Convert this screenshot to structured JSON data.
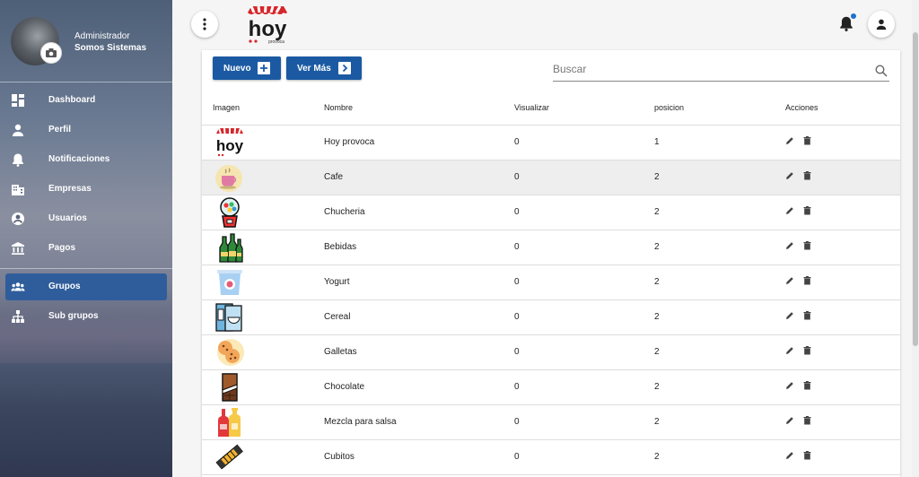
{
  "user": {
    "role": "Administrador",
    "company": "Somos Sistemas"
  },
  "nav": {
    "primary": [
      {
        "label": "Dashboard",
        "icon": "dashboard-icon"
      },
      {
        "label": "Perfil",
        "icon": "person-icon"
      },
      {
        "label": "Notificaciones",
        "icon": "bell-icon"
      },
      {
        "label": "Empresas",
        "icon": "building-icon"
      },
      {
        "label": "Usuarios",
        "icon": "account-circle-icon"
      },
      {
        "label": "Pagos",
        "icon": "bank-icon"
      }
    ],
    "secondary": [
      {
        "label": "Grupos",
        "icon": "groups-icon",
        "active": true
      },
      {
        "label": "Sub grupos",
        "icon": "hierarchy-icon"
      }
    ]
  },
  "brand": {
    "logo_text": "hoy",
    "logo_sub": "provoca",
    "accent": "#d6262b"
  },
  "toolbar": {
    "new_label": "Nuevo",
    "more_label": "Ver Más"
  },
  "search": {
    "placeholder": "Buscar",
    "value": ""
  },
  "table": {
    "headers": [
      "Imagen",
      "Nombre",
      "Visualizar",
      "posicion",
      "Acciones"
    ],
    "rows": [
      {
        "icon": "hoy-provoca-logo",
        "name": "Hoy provoca",
        "visualizar": "0",
        "posicion": "1"
      },
      {
        "icon": "coffee-cup-icon",
        "name": "Cafe",
        "visualizar": "0",
        "posicion": "2"
      },
      {
        "icon": "gumball-machine-icon",
        "name": "Chucheria",
        "visualizar": "0",
        "posicion": "2"
      },
      {
        "icon": "bottles-icon",
        "name": "Bebidas",
        "visualizar": "0",
        "posicion": "2"
      },
      {
        "icon": "yogurt-cup-icon",
        "name": "Yogurt",
        "visualizar": "0",
        "posicion": "2"
      },
      {
        "icon": "cereal-box-icon",
        "name": "Cereal",
        "visualizar": "0",
        "posicion": "2"
      },
      {
        "icon": "cookies-icon",
        "name": "Galletas",
        "visualizar": "0",
        "posicion": "2"
      },
      {
        "icon": "chocolate-bar-icon",
        "name": "Chocolate",
        "visualizar": "0",
        "posicion": "2"
      },
      {
        "icon": "sauce-bottles-icon",
        "name": "Mezcla para salsa",
        "visualizar": "0",
        "posicion": "2"
      },
      {
        "icon": "bouillon-cubes-icon",
        "name": "Cubitos",
        "visualizar": "0",
        "posicion": "2"
      }
    ]
  },
  "colors": {
    "primary_button": "#1b5aa3",
    "active_nav": "#2f5d9c",
    "row_highlight": "#eeeeee",
    "notification_dot": "#1e6fd0"
  }
}
